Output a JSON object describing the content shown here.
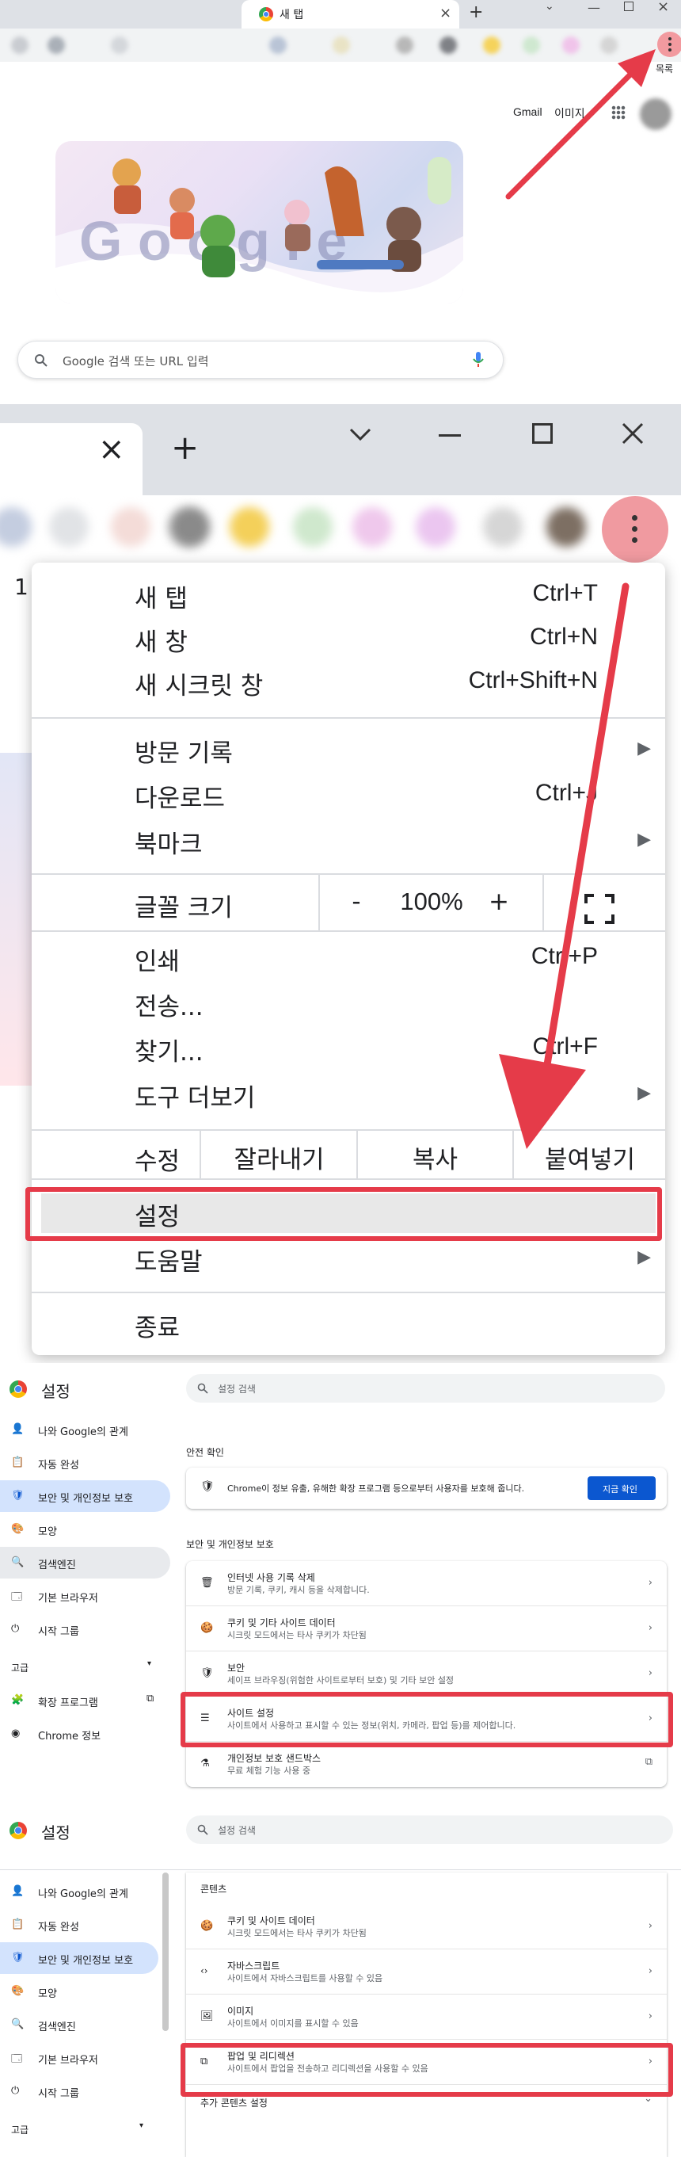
{
  "colors": {
    "highlight": "#e53b49",
    "accent": "#0b57d0",
    "active_nav": "#d3e3fd"
  },
  "panel1": {
    "tab_title": "새 탭",
    "new_tab_glyph": "+",
    "bookmarks_trailing": "목록",
    "links": {
      "gmail": "Gmail",
      "images": "이미지"
    },
    "search_placeholder": "Google 검색 또는 URL 입력"
  },
  "panel2": {
    "new_tab_glyph": "+",
    "partial_digit": "1",
    "menu": {
      "new_tab": {
        "label": "새 탭",
        "shortcut": "Ctrl+T"
      },
      "new_window": {
        "label": "새 창",
        "shortcut": "Ctrl+N"
      },
      "incognito": {
        "label": "새 시크릿 창",
        "shortcut": "Ctrl+Shift+N"
      },
      "history": {
        "label": "방문 기록"
      },
      "downloads": {
        "label": "다운로드",
        "shortcut": "Ctrl+J"
      },
      "bookmarks": {
        "label": "북마크"
      },
      "zoom": {
        "label": "글꼴 크기",
        "minus": "-",
        "value": "100%",
        "plus": "+"
      },
      "print": {
        "label": "인쇄",
        "shortcut": "Ctrl+P"
      },
      "cast": {
        "label": "전송..."
      },
      "find": {
        "label": "찾기...",
        "shortcut": "Ctrl+F"
      },
      "more_tools": {
        "label": "도구 더보기"
      },
      "edit": {
        "label": "수정",
        "cut": "잘라내기",
        "copy": "복사",
        "paste": "붙여넣기"
      },
      "settings": {
        "label": "설정"
      },
      "help": {
        "label": "도움말"
      },
      "exit": {
        "label": "종료"
      }
    }
  },
  "settings": {
    "title": "설정",
    "search_placeholder": "설정 검색",
    "nav": {
      "you_google": "나와 Google의 관계",
      "autofill": "자동 완성",
      "privacy": "보안 및 개인정보 보호",
      "appearance": "모양",
      "search_engine": "검색엔진",
      "default_browser": "기본 브라우저",
      "on_startup": "시작 그룹",
      "advanced": "고급",
      "extensions": "확장 프로그램",
      "about": "Chrome 정보"
    },
    "safety_check": {
      "heading": "안전 확인",
      "text": "Chrome이 정보 유출, 유해한 확장 프로그램 등으로부터 사용자를 보호해 줍니다.",
      "button": "지금 확인"
    },
    "privacy_section": {
      "heading": "보안 및 개인정보 보호",
      "rows": [
        {
          "title": "인터넷 사용 기록 삭제",
          "sub": "방문 기록, 쿠키, 캐시 등을 삭제합니다."
        },
        {
          "title": "쿠키 및 기타 사이트 데이터",
          "sub": "시크릿 모드에서는 타사 쿠키가 차단됨"
        },
        {
          "title": "보안",
          "sub": "세이프 브라우징(위험한 사이트로부터 보호) 및 기타 보안 설정"
        },
        {
          "title": "사이트 설정",
          "sub": "사이트에서 사용하고 표시할 수 있는 정보(위치, 카메라, 팝업 등)를 제어합니다."
        },
        {
          "title": "개인정보 보호 샌드박스",
          "sub": "무료 체험 기능 사용 중"
        }
      ]
    },
    "content_section": {
      "heading": "콘텐츠",
      "rows": [
        {
          "title": "쿠키 및 사이트 데이터",
          "sub": "시크릿 모드에서는 타사 쿠키가 차단됨"
        },
        {
          "title": "자바스크립트",
          "sub": "사이트에서 자바스크립트를 사용할 수 있음"
        },
        {
          "title": "이미지",
          "sub": "사이트에서 이미지를 표시할 수 있음"
        },
        {
          "title": "팝업 및 리디렉션",
          "sub": "사이트에서 팝업을 전송하고 리디렉션을 사용할 수 있음"
        }
      ],
      "more": "추가 콘텐츠 설정"
    }
  }
}
